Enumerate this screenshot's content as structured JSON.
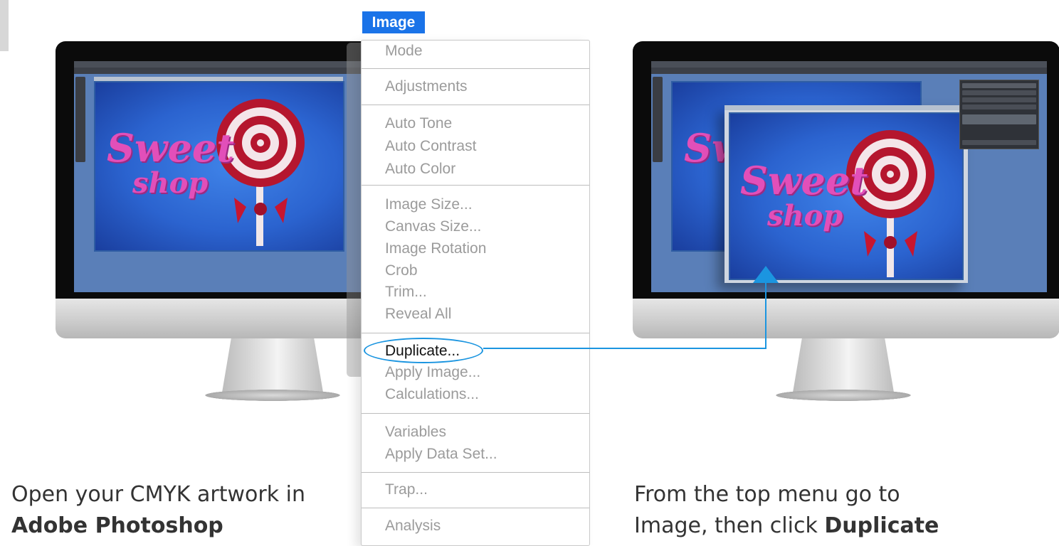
{
  "menu": {
    "title": "Image",
    "items": [
      {
        "label": "Mode",
        "enabled": false
      },
      {
        "label": "Adjustments",
        "enabled": false
      },
      {
        "label": "Auto Tone",
        "enabled": false
      },
      {
        "label": "Auto Contrast",
        "enabled": false
      },
      {
        "label": "Auto Color",
        "enabled": false
      },
      {
        "label": "Image Size...",
        "enabled": false
      },
      {
        "label": "Canvas Size...",
        "enabled": false
      },
      {
        "label": "Image Rotation",
        "enabled": false
      },
      {
        "label": "Crob",
        "enabled": false
      },
      {
        "label": "Trim...",
        "enabled": false
      },
      {
        "label": "Reveal All",
        "enabled": false
      },
      {
        "label": "Duplicate...",
        "enabled": true,
        "highlighted": true
      },
      {
        "label": "Apply Image...",
        "enabled": false
      },
      {
        "label": "Calculations...",
        "enabled": false
      },
      {
        "label": "Variables",
        "enabled": false
      },
      {
        "label": "Apply Data Set...",
        "enabled": false
      },
      {
        "label": "Trap...",
        "enabled": false
      },
      {
        "label": "Analysis",
        "enabled": false
      }
    ]
  },
  "left_caption": {
    "line1": "Open your CMYK artwork in",
    "line2_bold": "Adobe Photoshop"
  },
  "right_caption": {
    "line1": "From the top menu go to",
    "line2_prefix": "Image, then click ",
    "line2_bold": "Duplicate"
  },
  "artwork": {
    "text_line1": "Sweet",
    "text_line2": "shop"
  },
  "colors": {
    "menu_title_bg": "#1a73e8",
    "highlight_ring": "#1b95e0",
    "connector": "#1b95e0",
    "disabled_text": "#9b9b9b",
    "artwork_bg": "#2b63cf",
    "lollipop_red": "#b5162e",
    "candy_text": "#e24fb9"
  }
}
